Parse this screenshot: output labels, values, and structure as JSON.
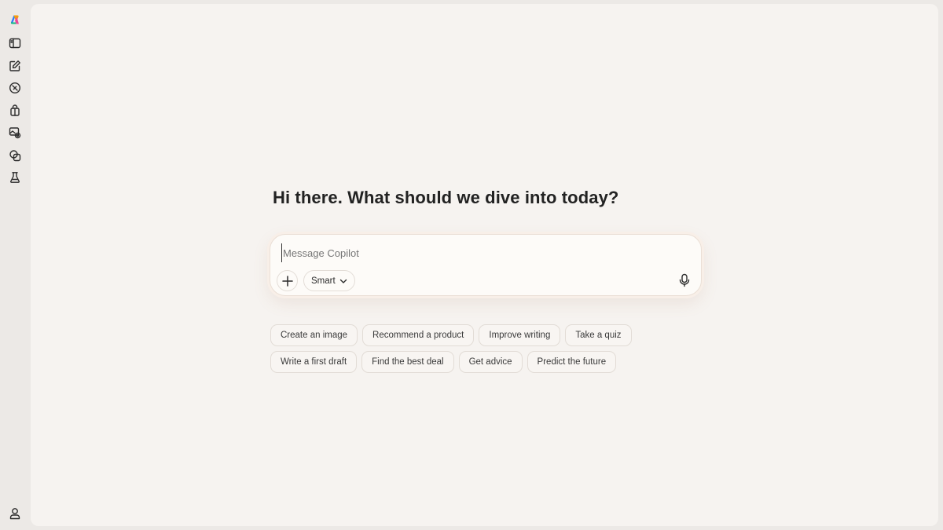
{
  "app": {
    "name": "Copilot"
  },
  "sidebar": {
    "top_icons": [
      {
        "icon": "copilot-logo-icon"
      },
      {
        "icon": "sidebar-toggle-icon"
      },
      {
        "icon": "new-chat-icon"
      },
      {
        "icon": "discover-icon"
      },
      {
        "icon": "shopping-icon"
      },
      {
        "icon": "image-create-icon"
      },
      {
        "icon": "pages-icon"
      },
      {
        "icon": "labs-icon"
      }
    ],
    "bottom_icons": [
      {
        "icon": "profile-icon"
      }
    ]
  },
  "main": {
    "greeting": "Hi there. What should we dive into today?"
  },
  "composer": {
    "placeholder": "Message Copilot",
    "value": "",
    "mode_label": "Smart"
  },
  "suggestions": {
    "row1": [
      "Create an image",
      "Recommend a product",
      "Improve writing",
      "Take a quiz"
    ],
    "row2": [
      "Write a first draft",
      "Find the best deal",
      "Get advice",
      "Predict the future"
    ]
  },
  "colors": {
    "outer_background": "#ece9e6",
    "main_background": "#f6f3f0",
    "composer_background": "#fdfbf8",
    "text_primary": "#222222",
    "logo_colors": [
      "#2f7df6",
      "#f59e0b",
      "#ec4899",
      "#10b981"
    ]
  }
}
